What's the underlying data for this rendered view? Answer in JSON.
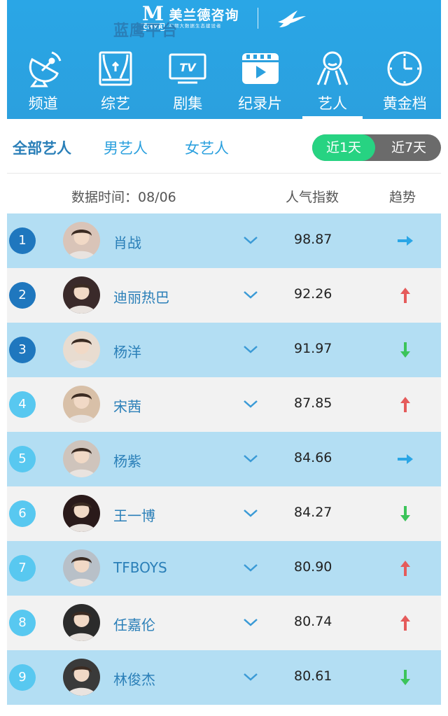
{
  "brand": {
    "left_title": "美兰德咨询",
    "left_sub": "视频大数据生态建设者",
    "logo_letter": "M",
    "logo_abbr": "CMMR",
    "right_title": "蓝鹰平台"
  },
  "nav": [
    {
      "label": "频道",
      "icon": "satellite-dish-icon"
    },
    {
      "label": "综艺",
      "icon": "stage-curtain-icon"
    },
    {
      "label": "剧集",
      "icon": "tv-icon"
    },
    {
      "label": "纪录片",
      "icon": "film-play-icon"
    },
    {
      "label": "艺人",
      "icon": "person-icon",
      "active": true
    },
    {
      "label": "黄金档",
      "icon": "clock-icon"
    }
  ],
  "tv_icon_text": "TV",
  "filters": {
    "all": "全部艺人",
    "male": "男艺人",
    "female": "女艺人",
    "range_1": "近1天",
    "range_7": "近7天"
  },
  "columns": {
    "date": "数据时间：08/06",
    "popularity": "人气指数",
    "trend": "趋势"
  },
  "rows": [
    {
      "rank": "1",
      "name": "肖战",
      "score": "98.87",
      "trend": "flat"
    },
    {
      "rank": "2",
      "name": "迪丽热巴",
      "score": "92.26",
      "trend": "up"
    },
    {
      "rank": "3",
      "name": "杨洋",
      "score": "91.97",
      "trend": "down"
    },
    {
      "rank": "4",
      "name": "宋茜",
      "score": "87.85",
      "trend": "up"
    },
    {
      "rank": "5",
      "name": "杨紫",
      "score": "84.66",
      "trend": "flat"
    },
    {
      "rank": "6",
      "name": "王一博",
      "score": "84.27",
      "trend": "down"
    },
    {
      "rank": "7",
      "name": "TFBOYS",
      "score": "80.90",
      "trend": "up"
    },
    {
      "rank": "8",
      "name": "任嘉伦",
      "score": "80.74",
      "trend": "up"
    },
    {
      "rank": "9",
      "name": "林俊杰",
      "score": "80.61",
      "trend": "down"
    }
  ],
  "colors": {
    "header_blue": "#2ba0de",
    "row_blue": "#b3def3",
    "row_gray": "#f2f2f2",
    "rank_top": "#1f77be",
    "rank_rest": "#58c8f0",
    "trend_up": "#e55b5b",
    "trend_down": "#3cc45a",
    "trend_flat": "#2aa6e6",
    "toggle_on": "#27d382"
  }
}
